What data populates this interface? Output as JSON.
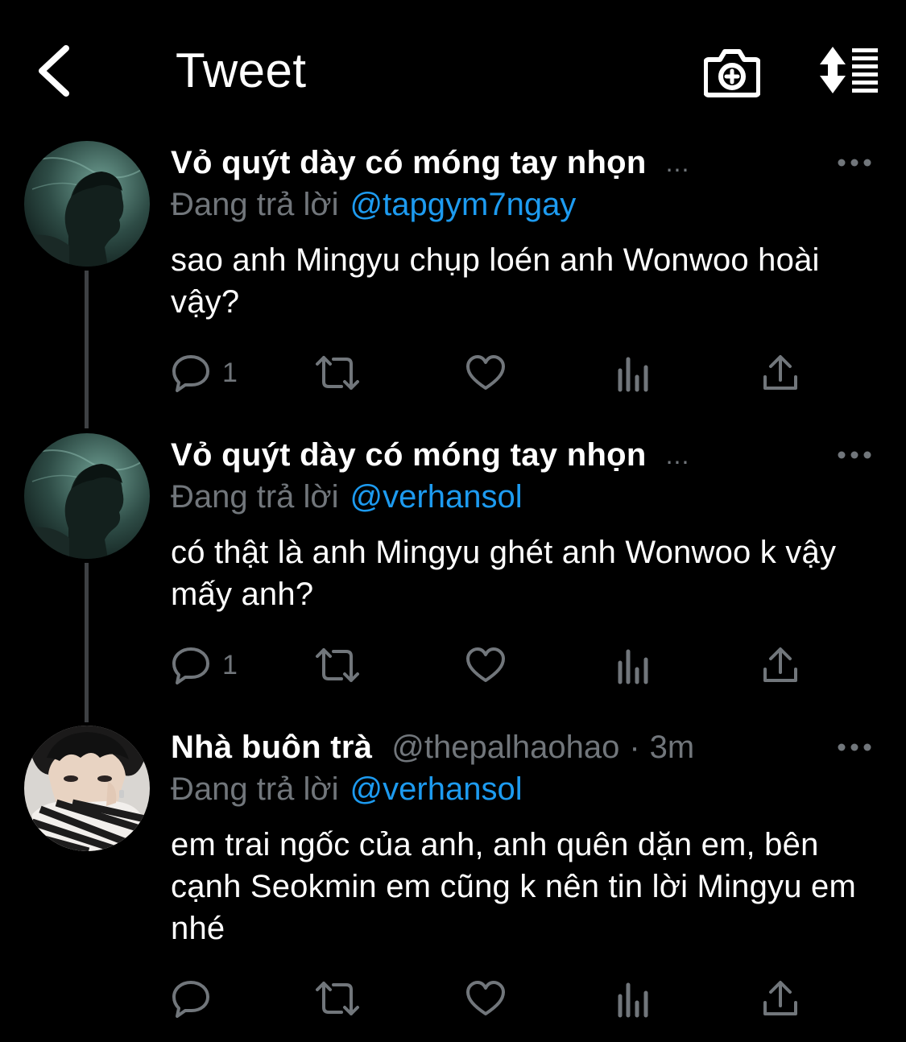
{
  "header": {
    "title": "Tweet"
  },
  "colors": {
    "background": "#000000",
    "text": "#ffffff",
    "muted": "#71767b",
    "accent": "#1d9bf0",
    "thread_line": "#3e4144"
  },
  "tweets": [
    {
      "display_name": "Vỏ quýt dày có móng tay nhọn",
      "name_overflow": "...",
      "reply_prefix": "Đang trả lời",
      "reply_to": "@tapgym7ngay",
      "text": "sao anh Mingyu chụp loén anh Wonwoo hoài vậy?",
      "reply_count": "1"
    },
    {
      "display_name": "Vỏ quýt dày có móng tay nhọn",
      "name_overflow": "...",
      "reply_prefix": "Đang trả lời",
      "reply_to": "@verhansol",
      "text": "có thật là anh Mingyu ghét anh Wonwoo k vậy mấy anh?",
      "reply_count": "1"
    },
    {
      "display_name": "Nhà buôn trà",
      "handle": "@thepalhaohao",
      "separator": "·",
      "timestamp": "3m",
      "reply_prefix": "Đang trả lời",
      "reply_to": "@verhansol",
      "text": "em trai ngốc của anh, anh quên dặn em, bên cạnh Seokmin em cũng k nên tin lời Mingyu em nhé",
      "reply_count": ""
    }
  ],
  "icons": {
    "back": "chevron-left-icon",
    "camera": "camera-plus-icon",
    "sort": "sort-icon",
    "more": "more-horizontal-icon",
    "reply": "reply-icon",
    "retweet": "retweet-icon",
    "like": "heart-icon",
    "views": "analytics-icon",
    "share": "share-icon"
  }
}
